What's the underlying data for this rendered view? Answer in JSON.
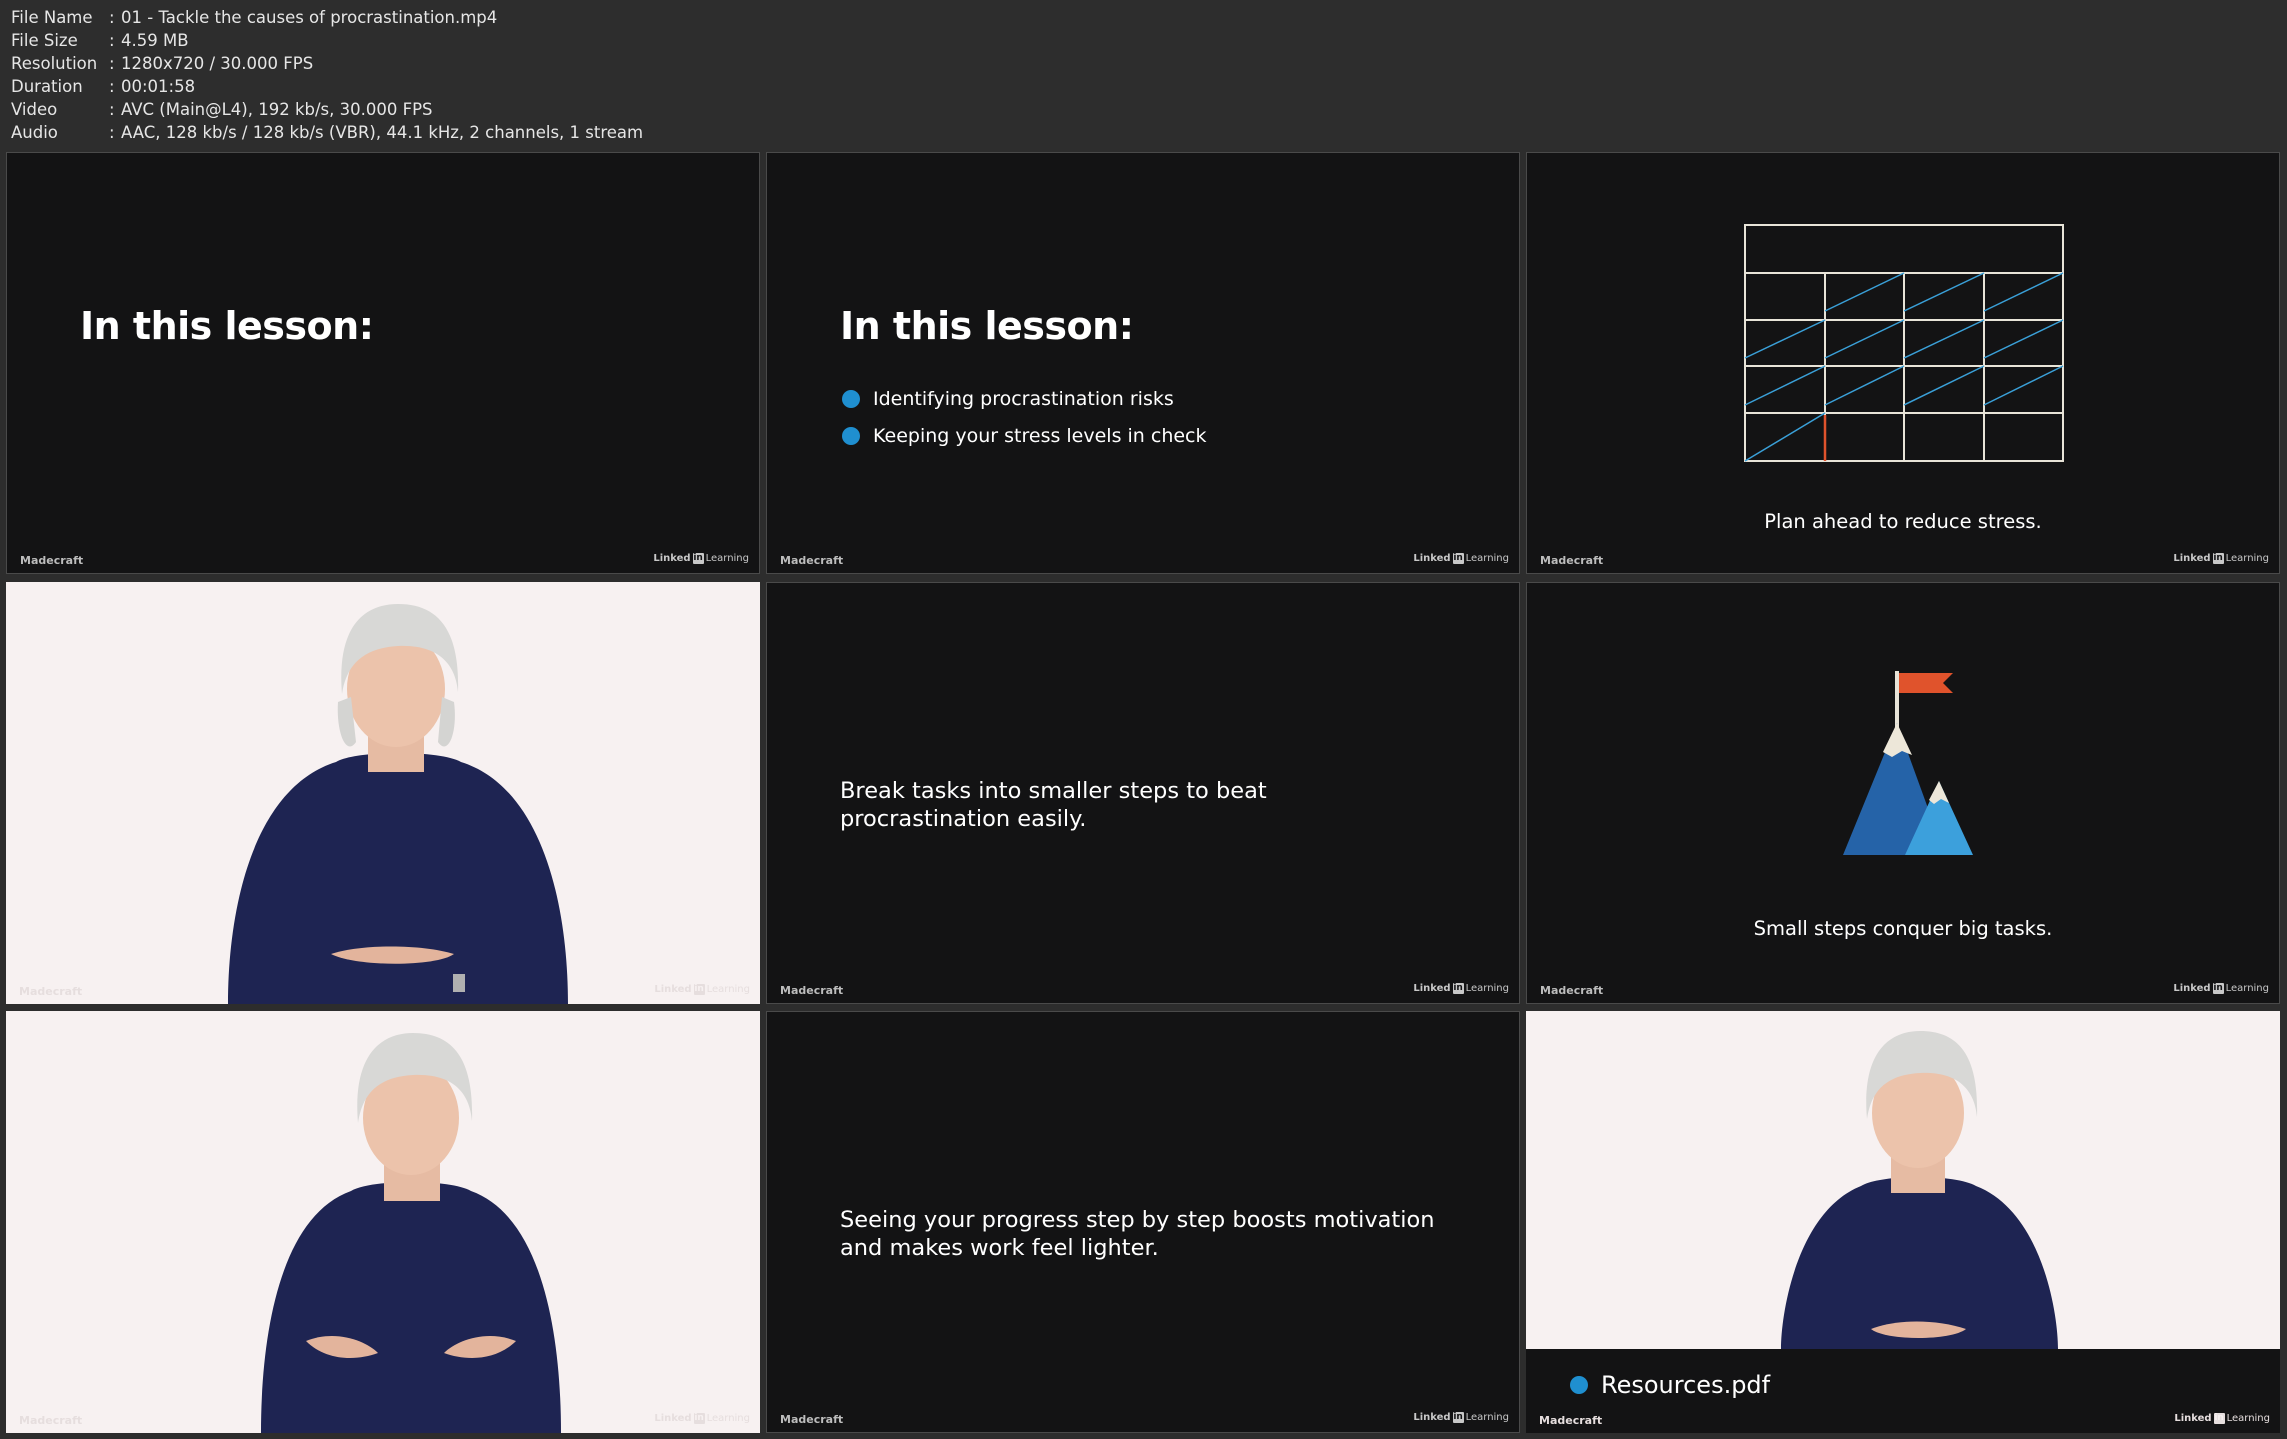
{
  "info": {
    "rows": [
      {
        "label": "File Name",
        "sep": ":",
        "value": "01 - Tackle the causes of procrastination.mp4"
      },
      {
        "label": "File Size",
        "sep": ":",
        "value": "4.59 MB"
      },
      {
        "label": "Resolution",
        "sep": ":",
        "value": "1280x720 / 30.000 FPS"
      },
      {
        "label": "Duration",
        "sep": ":",
        "value": "00:01:58"
      },
      {
        "label": "Video",
        "sep": ":",
        "value": "AVC (Main@L4), 192 kb/s, 30.000 FPS"
      },
      {
        "label": "Audio",
        "sep": ":",
        "value": "AAC, 128 kb/s / 128 kb/s (VBR), 44.1 kHz, 2 channels, 1 stream"
      }
    ]
  },
  "branding": {
    "madecraft": "Madecraft",
    "linked": "Linked",
    "in": "in",
    "learning": "Learning"
  },
  "frames": {
    "f1": {
      "heading": "In this lesson:"
    },
    "f2": {
      "heading": "In this lesson:",
      "bullets": [
        "Identifying procrastination risks",
        "Keeping your stress levels in check"
      ]
    },
    "f3": {
      "caption": "Plan ahead to reduce stress."
    },
    "f5": {
      "text_line1": "Break tasks into smaller steps to beat",
      "text_line2": "procrastination easily."
    },
    "f6": {
      "caption": "Small steps conquer big tasks."
    },
    "f8": {
      "text_line1": "Seeing your progress step by step boosts motivation",
      "text_line2": "and makes work feel lighter."
    },
    "f9": {
      "resource": "Resources.pdf"
    }
  },
  "colors": {
    "slide_bg": "#131314",
    "accent_blue": "#1f8fd0",
    "flag": "#e0532c",
    "mountain_dark": "#2563a8",
    "mountain_light": "#3ca0dc",
    "shirt": "#1e2452",
    "backdrop": "#f7f1f1"
  },
  "icons": [
    "calendar-grid-illustration",
    "mountain-flag-illustration",
    "bullet-dot-icon"
  ]
}
